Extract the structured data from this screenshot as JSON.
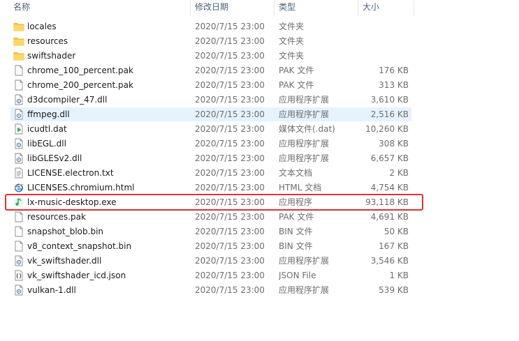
{
  "columns": {
    "name": "名称",
    "date": "修改日期",
    "type": "类型",
    "size": "大小"
  },
  "files": [
    {
      "name": "locales",
      "date": "2020/7/15 23:00",
      "type": "文件夹",
      "size": "",
      "icon": "folder-icon"
    },
    {
      "name": "resources",
      "date": "2020/7/15 23:00",
      "type": "文件夹",
      "size": "",
      "icon": "folder-icon"
    },
    {
      "name": "swiftshader",
      "date": "2020/7/15 23:00",
      "type": "文件夹",
      "size": "",
      "icon": "folder-icon"
    },
    {
      "name": "chrome_100_percent.pak",
      "date": "2020/7/15 23:00",
      "type": "PAK 文件",
      "size": "176 KB",
      "icon": "file-icon"
    },
    {
      "name": "chrome_200_percent.pak",
      "date": "2020/7/15 23:00",
      "type": "PAK 文件",
      "size": "313 KB",
      "icon": "file-icon"
    },
    {
      "name": "d3dcompiler_47.dll",
      "date": "2020/7/15 23:00",
      "type": "应用程序扩展",
      "size": "3,610 KB",
      "icon": "dll-icon"
    },
    {
      "name": "ffmpeg.dll",
      "date": "2020/7/15 23:00",
      "type": "应用程序扩展",
      "size": "2,516 KB",
      "icon": "dll-icon"
    },
    {
      "name": "icudtl.dat",
      "date": "2020/7/15 23:00",
      "type": "媒体文件(.dat)",
      "size": "10,260 KB",
      "icon": "media-file-icon"
    },
    {
      "name": "libEGL.dll",
      "date": "2020/7/15 23:00",
      "type": "应用程序扩展",
      "size": "308 KB",
      "icon": "dll-icon"
    },
    {
      "name": "libGLESv2.dll",
      "date": "2020/7/15 23:00",
      "type": "应用程序扩展",
      "size": "6,657 KB",
      "icon": "dll-icon"
    },
    {
      "name": "LICENSE.electron.txt",
      "date": "2020/7/15 23:00",
      "type": "文本文档",
      "size": "2 KB",
      "icon": "text-file-icon"
    },
    {
      "name": "LICENSES.chromium.html",
      "date": "2020/7/15 23:00",
      "type": "HTML 文档",
      "size": "4,754 KB",
      "icon": "browser-icon"
    },
    {
      "name": "lx-music-desktop.exe",
      "date": "2020/7/15 23:00",
      "type": "应用程序",
      "size": "93,118 KB",
      "icon": "music-app-icon"
    },
    {
      "name": "resources.pak",
      "date": "2020/7/15 23:00",
      "type": "PAK 文件",
      "size": "4,691 KB",
      "icon": "file-icon"
    },
    {
      "name": "snapshot_blob.bin",
      "date": "2020/7/15 23:00",
      "type": "BIN 文件",
      "size": "50 KB",
      "icon": "file-icon"
    },
    {
      "name": "v8_context_snapshot.bin",
      "date": "2020/7/15 23:00",
      "type": "BIN 文件",
      "size": "167 KB",
      "icon": "file-icon"
    },
    {
      "name": "vk_swiftshader.dll",
      "date": "2020/7/15 23:00",
      "type": "应用程序扩展",
      "size": "3,546 KB",
      "icon": "dll-icon"
    },
    {
      "name": "vk_swiftshader_icd.json",
      "date": "2020/7/15 23:00",
      "type": "JSON File",
      "size": "1 KB",
      "icon": "json-file-icon"
    },
    {
      "name": "vulkan-1.dll",
      "date": "2020/7/15 23:00",
      "type": "应用程序扩展",
      "size": "539 KB",
      "icon": "dll-icon"
    }
  ],
  "hover_index": 6,
  "highlight_index": 12,
  "colors": {
    "highlight_border": "#e03030",
    "hover_background": "#e5f3ff",
    "folder": "#f5c84c"
  }
}
